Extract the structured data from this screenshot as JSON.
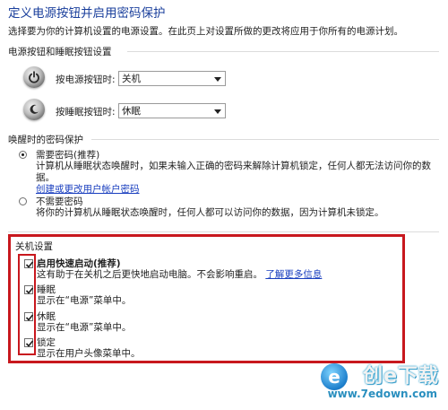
{
  "header": {
    "title": "定义电源按钮并启用密码保护",
    "subtitle": "选择要为你的计算机设置的电源设置。在此页上对设置所做的更改将应用于你所有的电源计划。"
  },
  "power_section": {
    "title": "电源按钮和睡眠按钮设置",
    "rows": [
      {
        "label": "按电源按钮时:",
        "value": "关机",
        "icon": "power-button-icon"
      },
      {
        "label": "按睡眠按钮时:",
        "value": "休眠",
        "icon": "sleep-button-icon"
      }
    ]
  },
  "wake_section": {
    "title": "唤醒时的密码保护",
    "require": {
      "label": "需要密码(推荐)",
      "desc": "计算机从睡眠状态唤醒时，如果未输入正确的密码来解除计算机锁定，任何人都无法访问你的数据。",
      "link": "创建或更改用户帐户密码",
      "selected": true
    },
    "no_require": {
      "label": "不需要密码",
      "desc": "将你的计算机从睡眠状态唤醒时，任何人都可以访问你的数据，因为计算机未锁定。",
      "selected": false
    }
  },
  "shutdown_section": {
    "title": "关机设置",
    "items": [
      {
        "label": "启用快速启动(推荐)",
        "desc": "这有助于在关机之后更快地启动电脑。不会影响重启。",
        "link": "了解更多信息",
        "checked": true,
        "bold": true
      },
      {
        "label": "睡眠",
        "desc": "显示在“电源”菜单中。",
        "checked": true
      },
      {
        "label": "休眠",
        "desc": "显示在“电源”菜单中。",
        "checked": true
      },
      {
        "label": "锁定",
        "desc": "显示在用户头像菜单中。",
        "checked": true
      }
    ]
  },
  "watermark": {
    "brand": "创e下载",
    "badge": "e",
    "url": "www.7edown.com"
  },
  "colors": {
    "title": "#1a3f9c",
    "link": "#1a3fbf",
    "highlight": "#c8181e"
  }
}
